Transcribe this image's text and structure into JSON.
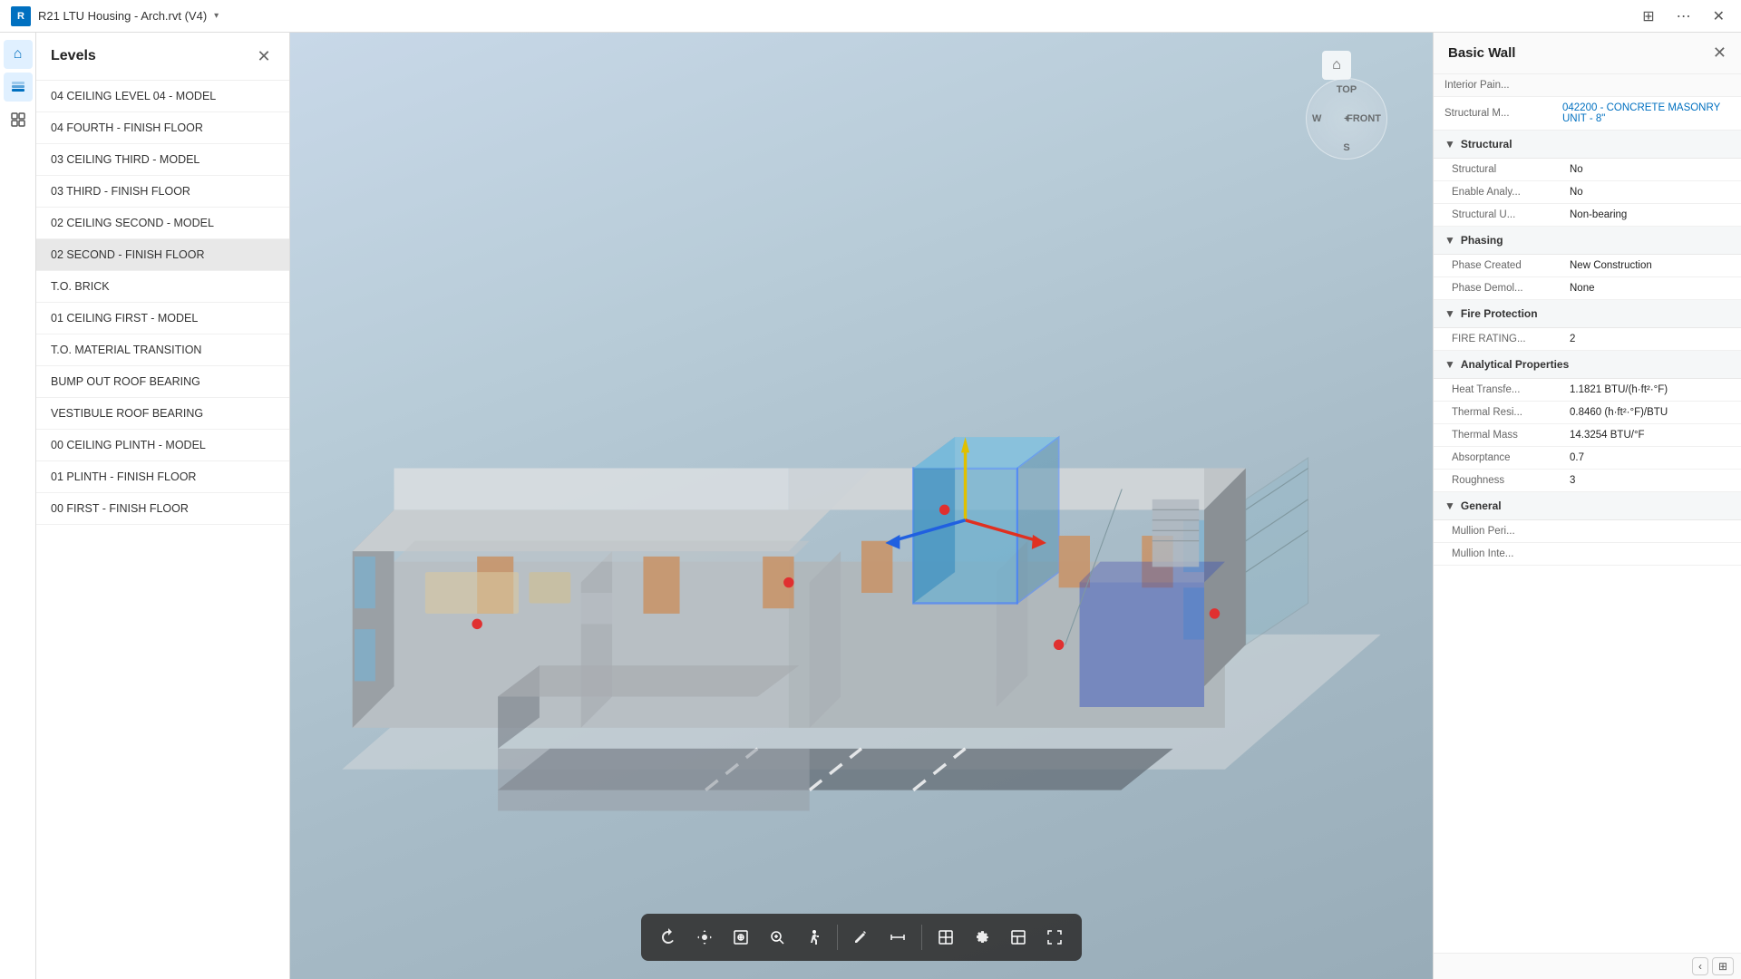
{
  "titlebar": {
    "app_icon": "revit-icon",
    "title": "R21 LTU Housing - Arch.rvt (V4)",
    "dropdown_arrow": "▾",
    "btn_tablet": "⊞",
    "btn_more": "⋯",
    "btn_close": "✕"
  },
  "side_icons": [
    {
      "name": "home-icon",
      "glyph": "⌂",
      "active": false
    },
    {
      "name": "layers-icon",
      "glyph": "◫",
      "active": true
    },
    {
      "name": "structure-icon",
      "glyph": "⊞",
      "active": false
    }
  ],
  "levels_panel": {
    "title": "Levels",
    "close_btn": "✕",
    "items": [
      {
        "label": "04 CEILING LEVEL 04 - MODEL",
        "active": false
      },
      {
        "label": "04 FOURTH - FINISH FLOOR",
        "active": false
      },
      {
        "label": "03 CEILING THIRD - MODEL",
        "active": false
      },
      {
        "label": "03 THIRD - FINISH FLOOR",
        "active": false
      },
      {
        "label": "02 CEILING SECOND - MODEL",
        "active": false
      },
      {
        "label": "02 SECOND - FINISH FLOOR",
        "active": true
      },
      {
        "label": "T.O. BRICK",
        "active": false
      },
      {
        "label": "01 CEILING FIRST - MODEL",
        "active": false
      },
      {
        "label": "T.O. MATERIAL TRANSITION",
        "active": false
      },
      {
        "label": "BUMP OUT ROOF BEARING",
        "active": false
      },
      {
        "label": "VESTIBULE ROOF BEARING",
        "active": false
      },
      {
        "label": "00 CEILING PLINTH - MODEL",
        "active": false
      },
      {
        "label": "01 PLINTH - FINISH FLOOR",
        "active": false
      },
      {
        "label": "00 FIRST - FINISH FLOOR",
        "active": false
      }
    ]
  },
  "compass": {
    "top": "TOP",
    "front": "FRONT",
    "south": "S",
    "west": "W"
  },
  "toolbar": {
    "buttons": [
      {
        "name": "rotate-tool",
        "glyph": "⟳",
        "active": false
      },
      {
        "name": "pan-tool",
        "glyph": "✋",
        "active": false
      },
      {
        "name": "zoom-region-tool",
        "glyph": "⊡",
        "active": false
      },
      {
        "name": "zoom-tool",
        "glyph": "⊕",
        "active": false
      },
      {
        "name": "walk-tool",
        "glyph": "🚶",
        "active": false
      },
      {
        "name": "measure-tool",
        "glyph": "⬆",
        "active": false
      },
      {
        "name": "measure2-tool",
        "glyph": "↔",
        "active": false
      },
      {
        "name": "section-box-tool",
        "glyph": "⊞",
        "active": false
      },
      {
        "name": "settings-tool",
        "glyph": "⚙",
        "active": false
      },
      {
        "name": "model-tool",
        "glyph": "◱",
        "active": false
      },
      {
        "name": "fullscreen-tool",
        "glyph": "⛶",
        "active": false
      }
    ]
  },
  "properties_panel": {
    "title": "Basic Wall",
    "close_btn": "✕",
    "type_label": "042200 - CONCRETE MASONRY UNIT - 8\"",
    "sections": [
      {
        "name": "Structural",
        "collapsed": false,
        "rows": [
          {
            "label": "Structural",
            "value": "No"
          },
          {
            "label": "Enable Analy...",
            "value": "No"
          },
          {
            "label": "Structural U...",
            "value": "Non-bearing"
          }
        ]
      },
      {
        "name": "Phasing",
        "collapsed": false,
        "rows": [
          {
            "label": "Phase Created",
            "value": "New Construction"
          },
          {
            "label": "Phase Demol...",
            "value": "None"
          }
        ]
      },
      {
        "name": "Fire Protection",
        "collapsed": false,
        "rows": [
          {
            "label": "FIRE RATING...",
            "value": "2"
          }
        ]
      },
      {
        "name": "Analytical Properties",
        "collapsed": false,
        "rows": [
          {
            "label": "Heat Transfe...",
            "value": "1.1821 BTU/(h·ft²·°F)"
          },
          {
            "label": "Thermal Resi...",
            "value": "0.8460 (h·ft²·°F)/BTU"
          },
          {
            "label": "Thermal Mass",
            "value": "14.3254 BTU/°F"
          },
          {
            "label": "Absorptance",
            "value": "0.7"
          },
          {
            "label": "Roughness",
            "value": "3"
          }
        ]
      },
      {
        "name": "General",
        "collapsed": false,
        "rows": [
          {
            "label": "Mullion Peri...",
            "value": ""
          },
          {
            "label": "Mullion Inte...",
            "value": ""
          }
        ]
      }
    ],
    "interior_paint_label": "Interior Pain...",
    "structural_m_label": "Structural M...",
    "structural_m_value": "042200 - CONCRETE MASONRY UNIT - 8\""
  },
  "viewport": {
    "home_icon": "⌂"
  },
  "colors": {
    "accent_blue": "#0070c0",
    "panel_bg": "#ffffff",
    "section_header_bg": "#f5f7f8",
    "toolbar_bg": "rgba(50,50,50,0.9)",
    "selected_element": "#6ab0d0",
    "highlight_blue": "#4080ff"
  }
}
